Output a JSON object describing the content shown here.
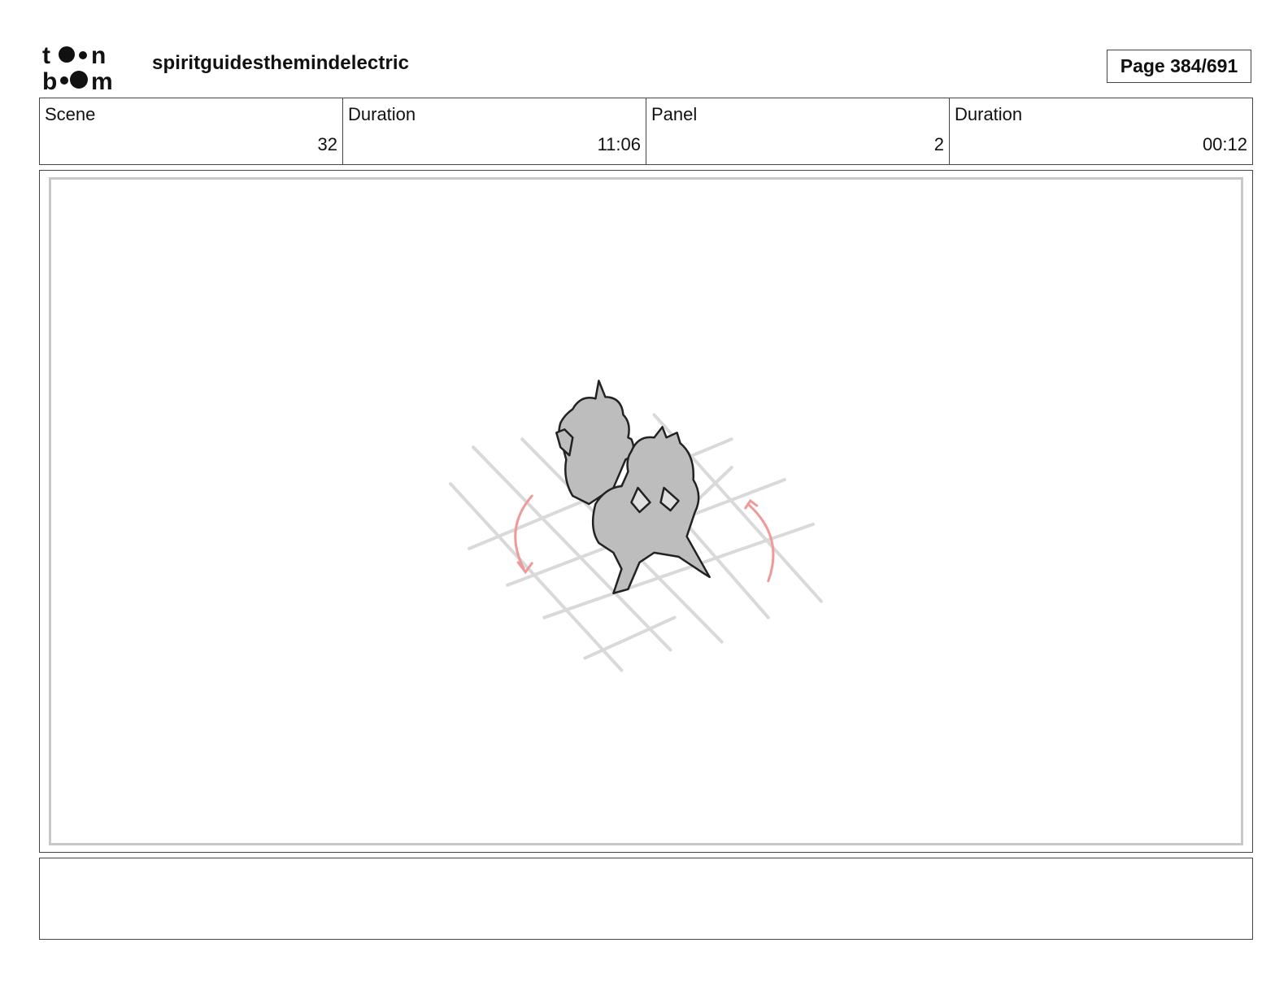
{
  "header": {
    "logo_text": "toon boom",
    "project_title": "spiritguidesthemindelectric",
    "page_label": "Page 384/691"
  },
  "info": [
    {
      "label": "Scene",
      "value": "32"
    },
    {
      "label": "Duration",
      "value": "11:06"
    },
    {
      "label": "Panel",
      "value": "2"
    },
    {
      "label": "Duration",
      "value": "00:12"
    }
  ],
  "panel": {
    "sketch_stroke": "#222222",
    "sketch_fill": "#bdbdbd",
    "grid_color": "#d9d9d9",
    "arrow_color": "#ef9a9a"
  },
  "notes": {
    "text": ""
  }
}
